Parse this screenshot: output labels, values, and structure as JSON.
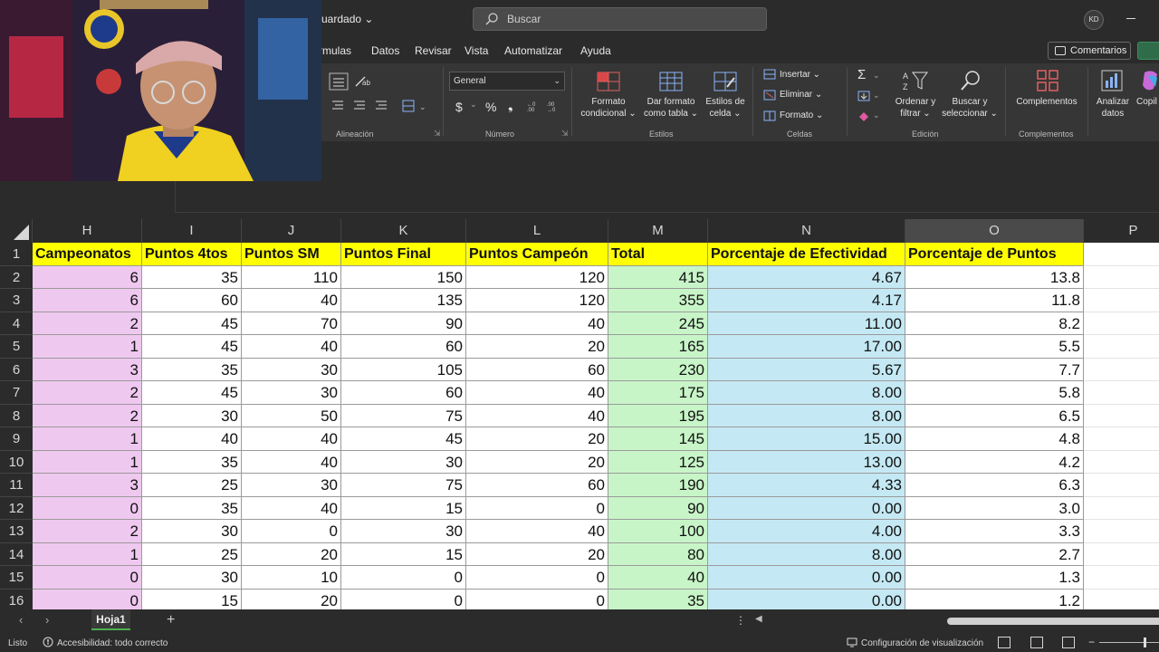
{
  "titlebar": {
    "file_name": "uardado ⌄",
    "search_placeholder": "Buscar",
    "avatar_initials": "KD"
  },
  "menu": {
    "tabs": [
      {
        "label": "rmulas"
      },
      {
        "label": "Datos"
      },
      {
        "label": "Revisar"
      },
      {
        "label": "Vista"
      },
      {
        "label": "Automatizar"
      },
      {
        "label": "Ayuda"
      }
    ],
    "comments_label": "Comentarios"
  },
  "ribbon": {
    "groups": {
      "alineacion": "Alineación",
      "numero": "Número",
      "estilos": "Estilos",
      "celdas": "Celdas",
      "edicion": "Edición",
      "complementos": "Complementos"
    },
    "number_format": "General",
    "currency_symbol": "$",
    "percent_symbol": "%",
    "comma_symbol": "❟",
    "formato_condicional": "Formato condicional ⌄",
    "dar_formato_tabla": "Dar formato como tabla ⌄",
    "estilos_celda": "Estilos de celda ⌄",
    "insertar": "Insertar ⌄",
    "eliminar": "Eliminar ⌄",
    "formato": "Formato ⌄",
    "ordenar_filtrar": "Ordenar y filtrar ⌄",
    "buscar_seleccionar": "Buscar y seleccionar ⌄",
    "complementos_btn": "Complementos",
    "analizar_datos": "Analizar datos",
    "copilot": "Copil"
  },
  "grid": {
    "columns": [
      {
        "letter": "H",
        "selected": false
      },
      {
        "letter": "I",
        "selected": false
      },
      {
        "letter": "J",
        "selected": false
      },
      {
        "letter": "K",
        "selected": false
      },
      {
        "letter": "L",
        "selected": false
      },
      {
        "letter": "M",
        "selected": false
      },
      {
        "letter": "N",
        "selected": false
      },
      {
        "letter": "O",
        "selected": true
      },
      {
        "letter": "P",
        "selected": false
      }
    ],
    "row_numbers": [
      "1",
      "2",
      "3",
      "4",
      "5",
      "6",
      "7",
      "8",
      "9",
      "10",
      "11",
      "12",
      "13",
      "14",
      "15",
      "16"
    ],
    "headers": [
      "Campeonatos",
      "Puntos 4tos",
      "Puntos SM",
      "Puntos Final",
      "Puntos Campeón",
      "Total",
      "Porcentaje de Efectividad",
      "Porcentaje de Puntos"
    ],
    "rows": [
      [
        "6",
        "35",
        "110",
        "150",
        "120",
        "415",
        "4.67",
        "13.8"
      ],
      [
        "6",
        "60",
        "40",
        "135",
        "120",
        "355",
        "4.17",
        "11.8"
      ],
      [
        "2",
        "45",
        "70",
        "90",
        "40",
        "245",
        "11.00",
        "8.2"
      ],
      [
        "1",
        "45",
        "40",
        "60",
        "20",
        "165",
        "17.00",
        "5.5"
      ],
      [
        "3",
        "35",
        "30",
        "105",
        "60",
        "230",
        "5.67",
        "7.7"
      ],
      [
        "2",
        "45",
        "30",
        "60",
        "40",
        "175",
        "8.00",
        "5.8"
      ],
      [
        "2",
        "30",
        "50",
        "75",
        "40",
        "195",
        "8.00",
        "6.5"
      ],
      [
        "1",
        "40",
        "40",
        "45",
        "20",
        "145",
        "15.00",
        "4.8"
      ],
      [
        "1",
        "35",
        "40",
        "30",
        "20",
        "125",
        "13.00",
        "4.2"
      ],
      [
        "3",
        "25",
        "30",
        "75",
        "60",
        "190",
        "4.33",
        "6.3"
      ],
      [
        "0",
        "35",
        "40",
        "15",
        "0",
        "90",
        "0.00",
        "3.0"
      ],
      [
        "2",
        "30",
        "0",
        "30",
        "40",
        "100",
        "4.00",
        "3.3"
      ],
      [
        "1",
        "25",
        "20",
        "15",
        "20",
        "80",
        "8.00",
        "2.7"
      ],
      [
        "0",
        "30",
        "10",
        "0",
        "0",
        "40",
        "0.00",
        "1.3"
      ],
      [
        "0",
        "15",
        "20",
        "0",
        "0",
        "35",
        "0.00",
        "1.2"
      ]
    ],
    "colors": {
      "header": "#ffff00",
      "campeonatos": "#efc8f0",
      "total": "#c8f5c8",
      "efectividad": "#c4e9f4"
    }
  },
  "sheets": {
    "active": "Hoja1",
    "add": "+"
  },
  "status": {
    "ready": "Listo",
    "accessibility": "Accesibilidad: todo correcto",
    "view_settings": "Configuración de visualización",
    "zoom_minus": "−"
  }
}
